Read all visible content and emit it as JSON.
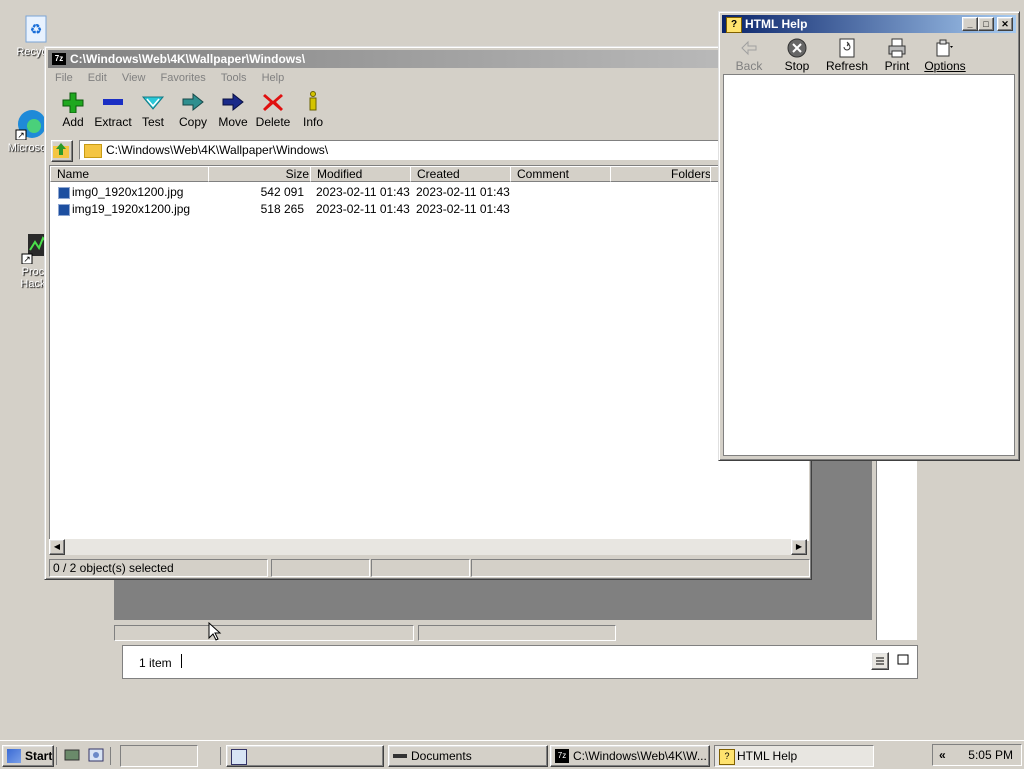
{
  "desktop": {
    "icons": [
      {
        "label": "Recycle",
        "icon": "recycle-bin-icon"
      },
      {
        "label": "Microsoft",
        "icon": "edge-icon"
      },
      {
        "label": "Proce\nHacke",
        "icon": "process-hacker-icon"
      }
    ]
  },
  "bg_window": {
    "status_text": "1 item",
    "view_icons": [
      "details-view-icon",
      "large-icons-view-icon"
    ]
  },
  "zip": {
    "title": "C:\\Windows\\Web\\4K\\Wallpaper\\Windows\\",
    "app_icon": "7z",
    "menu": [
      "File",
      "Edit",
      "View",
      "Favorites",
      "Tools",
      "Help"
    ],
    "toolbar": [
      {
        "label": "Add",
        "icon": "add-icon",
        "color": "#1fa81f"
      },
      {
        "label": "Extract",
        "icon": "extract-icon",
        "color": "#1a2ec4"
      },
      {
        "label": "Test",
        "icon": "test-icon",
        "color": "#2ac8d8"
      },
      {
        "label": "Copy",
        "icon": "copy-icon",
        "color": "#2f8f8f"
      },
      {
        "label": "Move",
        "icon": "move-icon",
        "color": "#1a2a8a"
      },
      {
        "label": "Delete",
        "icon": "delete-icon",
        "color": "#e01010"
      },
      {
        "label": "Info",
        "icon": "info-icon",
        "color": "#d4c400"
      }
    ],
    "address": "C:\\Windows\\Web\\4K\\Wallpaper\\Windows\\",
    "columns": [
      "Name",
      "Size",
      "Modified",
      "Created",
      "Comment",
      "Folders"
    ],
    "files": [
      {
        "name": "img0_1920x1200.jpg",
        "size": "542 091",
        "modified": "2023-02-11 01:43",
        "created": "2023-02-11 01:43"
      },
      {
        "name": "img19_1920x1200.jpg",
        "size": "518 265",
        "modified": "2023-02-11 01:43",
        "created": "2023-02-11 01:43"
      }
    ],
    "status": "0 / 2 object(s) selected"
  },
  "help": {
    "title": "HTML Help",
    "tools": [
      {
        "label": "Back",
        "icon": "back-icon",
        "enabled": false
      },
      {
        "label": "Stop",
        "icon": "stop-icon",
        "enabled": true
      },
      {
        "label": "Refresh",
        "icon": "refresh-icon",
        "enabled": true
      },
      {
        "label": "Print",
        "icon": "print-icon",
        "enabled": true
      },
      {
        "label": "Options",
        "icon": "options-icon",
        "enabled": true
      }
    ]
  },
  "taskbar": {
    "start": "Start",
    "tasks": [
      {
        "label": "",
        "icon": "explorer-icon"
      },
      {
        "label": "Documents",
        "icon": "documents-icon"
      },
      {
        "label": "C:\\Windows\\Web\\4K\\W...",
        "icon": "7zip-icon"
      },
      {
        "label": "HTML Help",
        "icon": "help-icon"
      }
    ],
    "tray_toggle": "«",
    "clock": "5:05 PM"
  }
}
